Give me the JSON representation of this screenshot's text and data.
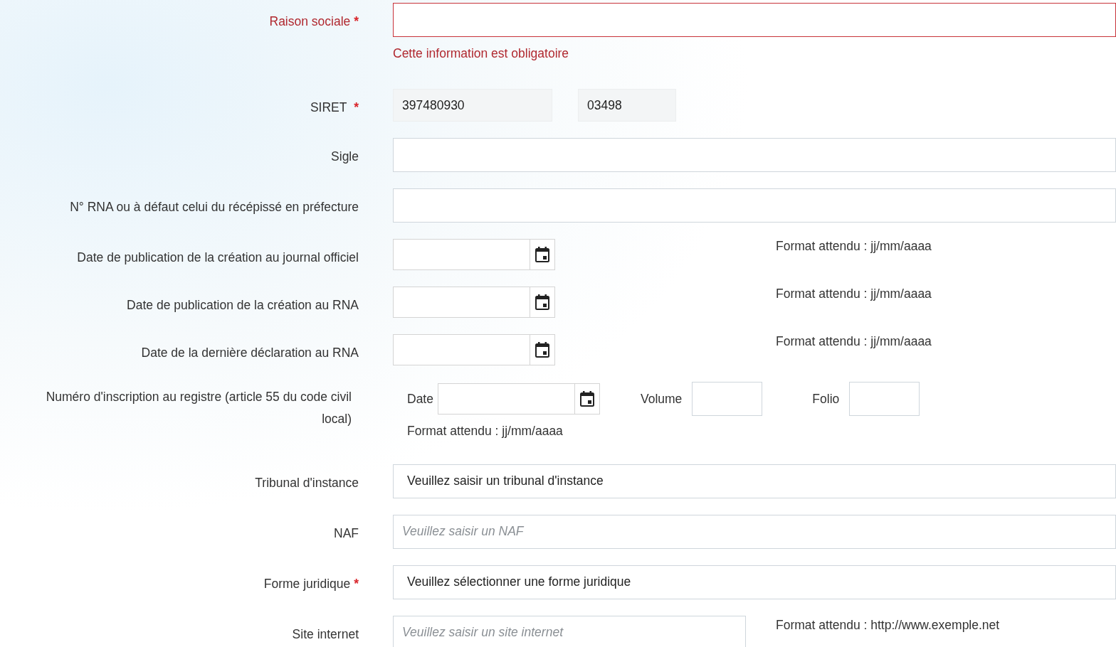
{
  "fields": [
    {
      "kind": "text",
      "label": "Raison sociale",
      "required_mark": "*",
      "invalid": true,
      "error": "Cette information est obligatoire"
    },
    {
      "kind": "siret",
      "label": "SIRET",
      "required_mark": "*",
      "values": [
        "397480930",
        "03498"
      ]
    },
    {
      "kind": "text",
      "label": "Sigle"
    },
    {
      "kind": "text",
      "label": "N° RNA ou à défaut celui du récépissé en préfecture"
    },
    {
      "kind": "date",
      "label": "Date de publication de la création au journal officiel",
      "hint": "Format attendu : jj/mm/aaaa"
    },
    {
      "kind": "date",
      "label": "Date de publication de la création au RNA",
      "hint": "Format attendu : jj/mm/aaaa"
    },
    {
      "kind": "date",
      "label": "Date de la dernière déclaration au RNA",
      "hint": "Format attendu : jj/mm/aaaa"
    },
    {
      "kind": "registry",
      "label": "Numéro d'inscription au registre (article 55 du code civil local)",
      "date_label": "Date",
      "hint": "Format attendu : jj/mm/aaaa",
      "volume_label": "Volume",
      "folio_label": "Folio"
    },
    {
      "kind": "select",
      "label": "Tribunal d'instance",
      "value": "Veuillez saisir un tribunal d'instance"
    },
    {
      "kind": "text",
      "label": "NAF",
      "placeholder": "Veuillez saisir un NAF"
    },
    {
      "kind": "select",
      "label": "Forme juridique",
      "required_mark": "*",
      "value": "Veuillez sélectionner une forme juridique"
    },
    {
      "kind": "text",
      "label": "Site internet",
      "placeholder": "Veuillez saisir un site internet",
      "hint": "Format attendu : http://www.exemple.net"
    }
  ]
}
